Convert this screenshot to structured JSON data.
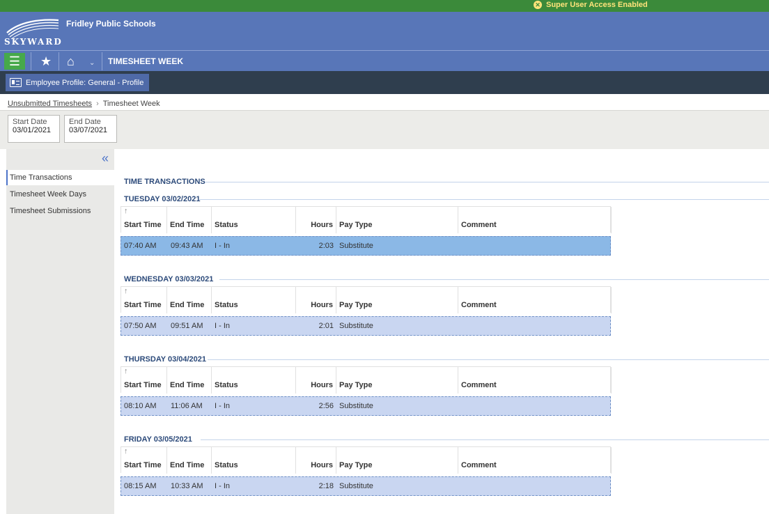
{
  "topbar": {
    "super_user": "Super User Access Enabled"
  },
  "header": {
    "logo_text": "SKYWARD",
    "district": "Fridley Public Schools"
  },
  "nav": {
    "title": "TIMESHEET WEEK"
  },
  "profile_button": "Employee Profile: General - Profile",
  "breadcrumb": {
    "parent": "Unsubmitted Timesheets",
    "current": "Timesheet Week"
  },
  "dates": {
    "start_label": "Start Date",
    "start_value": "03/01/2021",
    "end_label": "End Date",
    "end_value": "03/07/2021"
  },
  "sidebar": {
    "items": [
      {
        "label": "Time Transactions"
      },
      {
        "label": "Timesheet Week Days"
      },
      {
        "label": "Timesheet Submissions"
      }
    ]
  },
  "content": {
    "title": "TIME TRANSACTIONS",
    "columns": {
      "start": "Start Time",
      "end": "End Time",
      "status": "Status",
      "hours": "Hours",
      "pay_type": "Pay Type",
      "comment": "Comment"
    },
    "days": [
      {
        "label": "TUESDAY 03/02/2021",
        "row": {
          "start": "07:40 AM",
          "end": "09:43 AM",
          "status": "I - In",
          "hours": "2:03",
          "pay_type": "Substitute",
          "comment": ""
        }
      },
      {
        "label": "WEDNESDAY 03/03/2021",
        "row": {
          "start": "07:50 AM",
          "end": "09:51 AM",
          "status": "I - In",
          "hours": "2:01",
          "pay_type": "Substitute",
          "comment": ""
        }
      },
      {
        "label": "THURSDAY 03/04/2021",
        "row": {
          "start": "08:10 AM",
          "end": "11:06 AM",
          "status": "I - In",
          "hours": "2:56",
          "pay_type": "Substitute",
          "comment": ""
        }
      },
      {
        "label": "FRIDAY 03/05/2021",
        "row": {
          "start": "08:15 AM",
          "end": "10:33 AM",
          "status": "I - In",
          "hours": "2:18",
          "pay_type": "Substitute",
          "comment": ""
        }
      }
    ]
  },
  "colors": {
    "header": "#5876b8",
    "topbar": "#3b8a3a",
    "profilebar": "#2f3e4e",
    "selected_row": "#8bb8e6",
    "row": "#c9d6f1"
  }
}
